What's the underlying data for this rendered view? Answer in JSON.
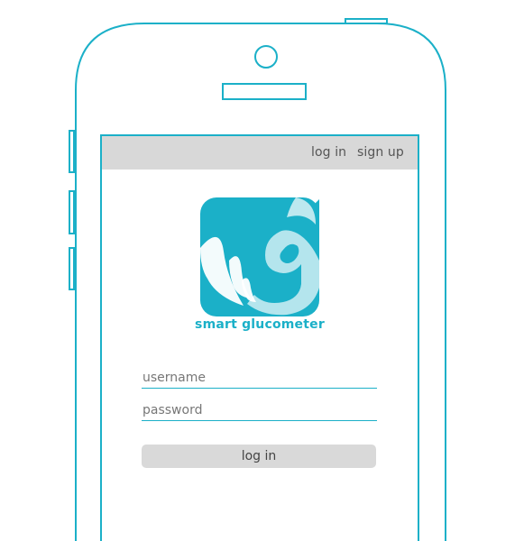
{
  "nav": {
    "login_label": "log in",
    "signup_label": "sign up"
  },
  "logo": {
    "text": "smart glucometer"
  },
  "form": {
    "username_placeholder": "username",
    "password_placeholder": "password",
    "login_button_label": "log in"
  },
  "colors": {
    "accent": "#1bb0c8",
    "nav_bg": "#d8d8d8",
    "button_bg": "#d9d9d9"
  }
}
